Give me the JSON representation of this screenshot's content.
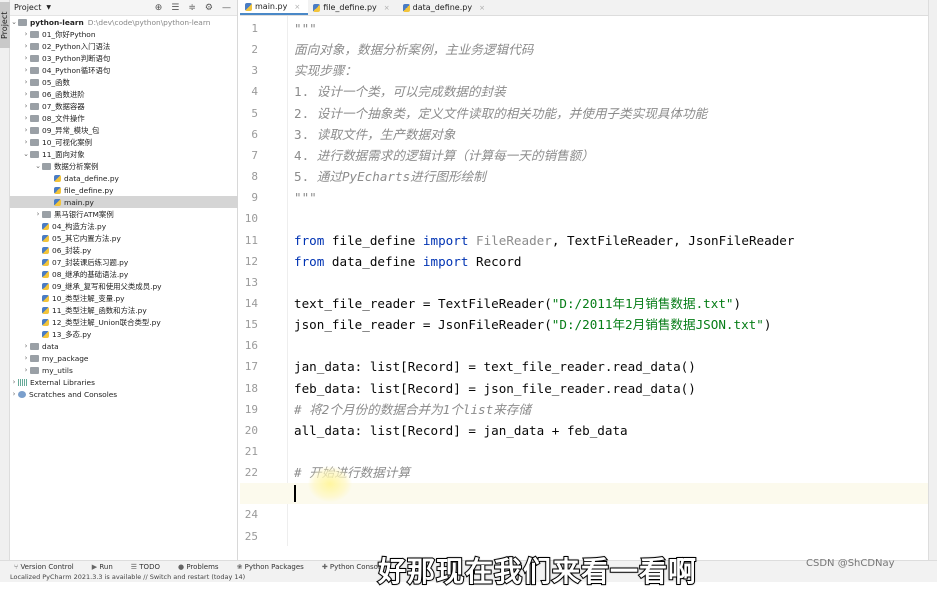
{
  "sidebar": {
    "strip_label": "Project",
    "title": "Project",
    "root": {
      "name": "python-learn",
      "path": "D:\\dev\\code\\python\\python-learn"
    },
    "items": [
      {
        "label": "01_你好Python",
        "type": "folder",
        "depth": 1,
        "state": "collapsed"
      },
      {
        "label": "02_Python入门语法",
        "type": "folder",
        "depth": 1,
        "state": "collapsed"
      },
      {
        "label": "03_Python判断语句",
        "type": "folder",
        "depth": 1,
        "state": "collapsed"
      },
      {
        "label": "04_Python循环语句",
        "type": "folder",
        "depth": 1,
        "state": "collapsed"
      },
      {
        "label": "05_函数",
        "type": "folder",
        "depth": 1,
        "state": "collapsed"
      },
      {
        "label": "06_函数进阶",
        "type": "folder",
        "depth": 1,
        "state": "collapsed"
      },
      {
        "label": "07_数据容器",
        "type": "folder",
        "depth": 1,
        "state": "collapsed"
      },
      {
        "label": "08_文件操作",
        "type": "folder",
        "depth": 1,
        "state": "collapsed"
      },
      {
        "label": "09_异常_模块_包",
        "type": "folder",
        "depth": 1,
        "state": "collapsed"
      },
      {
        "label": "10_可视化案例",
        "type": "folder",
        "depth": 1,
        "state": "collapsed"
      },
      {
        "label": "11_面向对象",
        "type": "folder",
        "depth": 1,
        "state": "expanded"
      },
      {
        "label": "数据分析案例",
        "type": "folder",
        "depth": 2,
        "state": "expanded"
      },
      {
        "label": "data_define.py",
        "type": "py",
        "depth": 3
      },
      {
        "label": "file_define.py",
        "type": "py",
        "depth": 3
      },
      {
        "label": "main.py",
        "type": "py",
        "depth": 3,
        "selected": true
      },
      {
        "label": "黑马银行ATM案例",
        "type": "folder",
        "depth": 2,
        "state": "collapsed"
      },
      {
        "label": "04_构造方法.py",
        "type": "py",
        "depth": 2
      },
      {
        "label": "05_其它内置方法.py",
        "type": "py",
        "depth": 2
      },
      {
        "label": "06_封装.py",
        "type": "py",
        "depth": 2
      },
      {
        "label": "07_封装课后练习题.py",
        "type": "py",
        "depth": 2
      },
      {
        "label": "08_继承的基础语法.py",
        "type": "py",
        "depth": 2
      },
      {
        "label": "09_继承_复写和使用父类成员.py",
        "type": "py",
        "depth": 2
      },
      {
        "label": "10_类型注解_变量.py",
        "type": "py",
        "depth": 2
      },
      {
        "label": "11_类型注解_函数和方法.py",
        "type": "py",
        "depth": 2
      },
      {
        "label": "12_类型注解_Union联合类型.py",
        "type": "py",
        "depth": 2
      },
      {
        "label": "13_多态.py",
        "type": "py",
        "depth": 2
      },
      {
        "label": "data",
        "type": "folder",
        "depth": 1,
        "state": "collapsed"
      },
      {
        "label": "my_package",
        "type": "folder",
        "depth": 1,
        "state": "collapsed"
      },
      {
        "label": "my_utils",
        "type": "folder",
        "depth": 1,
        "state": "collapsed"
      },
      {
        "label": "External Libraries",
        "type": "lib",
        "depth": 0,
        "state": "collapsed"
      },
      {
        "label": "Scratches and Consoles",
        "type": "scr",
        "depth": 0,
        "state": "collapsed"
      }
    ]
  },
  "tabs": [
    {
      "label": "main.py",
      "active": true
    },
    {
      "label": "file_define.py"
    },
    {
      "label": "data_define.py"
    }
  ],
  "editor": {
    "current_line": 23,
    "lines": [
      [
        [
          "\"\"\"",
          "ds"
        ]
      ],
      [
        [
          "面向对象，数据分析案例，主业务逻辑代码",
          "ds"
        ]
      ],
      [
        [
          "实现步骤：",
          "ds"
        ]
      ],
      [
        [
          "1. ",
          "ic"
        ],
        [
          "设计一个类，可以完成数据的封装",
          "ds"
        ]
      ],
      [
        [
          "2. ",
          "ic"
        ],
        [
          "设计一个抽象类，定义文件读取的相关功能，并使用子类实现具体功能",
          "ds"
        ]
      ],
      [
        [
          "3. ",
          "ic"
        ],
        [
          "读取文件，生产数据对象",
          "ds"
        ]
      ],
      [
        [
          "4. ",
          "ic"
        ],
        [
          "进行数据需求的逻辑计算（计算每一天的销售额）",
          "ds"
        ]
      ],
      [
        [
          "5. ",
          "ic"
        ],
        [
          "通过PyEcharts进行图形绘制",
          "ds"
        ]
      ],
      [
        [
          "\"\"\"",
          "ds"
        ]
      ],
      [],
      [
        [
          "from ",
          "kw"
        ],
        [
          "file_define ",
          ""
        ],
        [
          "import ",
          "kw"
        ],
        [
          "FileReader",
          "ic"
        ],
        [
          ", TextFileReader, JsonFileReader",
          ""
        ]
      ],
      [
        [
          "from ",
          "kw"
        ],
        [
          "data_define ",
          ""
        ],
        [
          "import ",
          "kw"
        ],
        [
          "Record",
          ""
        ]
      ],
      [],
      [
        [
          "text_file_reader = TextFileReader(",
          ""
        ],
        [
          "\"D:/2011年1月销售数据.txt\"",
          "st"
        ],
        [
          ")",
          ""
        ]
      ],
      [
        [
          "json_file_reader = JsonFileReader(",
          ""
        ],
        [
          "\"D:/2011年2月销售数据JSON.txt\"",
          "st"
        ],
        [
          ")",
          ""
        ]
      ],
      [],
      [
        [
          "jan_data: list[Record] = text_file_reader.read_data()",
          ""
        ]
      ],
      [
        [
          "feb_data: list[Record] = json_file_reader.read_data()",
          ""
        ]
      ],
      [
        [
          "# 将2个月份的数据合并为1个list来存储",
          "cm"
        ]
      ],
      [
        [
          "all_data: list[Record] = jan_data + feb_data",
          ""
        ]
      ],
      [],
      [
        [
          "# 开始进行数据计算",
          "cm"
        ]
      ],
      [],
      [],
      []
    ]
  },
  "bottom_tools": [
    "Version Control",
    "Run",
    "TODO",
    "Problems",
    "Python Packages",
    "Python Console"
  ],
  "status": "Localized PyCharm 2021.3.3 is available // Switch and restart (today 14)",
  "subtitle": "好那现在我们来看一看啊",
  "watermark": "CSDN @ShCDNay",
  "colors": {
    "keyword": "#0033b3",
    "string": "#067d17",
    "comment": "#8c8c8c",
    "current_line": "#fcfaed",
    "tab_accent": "#4a88c7"
  }
}
